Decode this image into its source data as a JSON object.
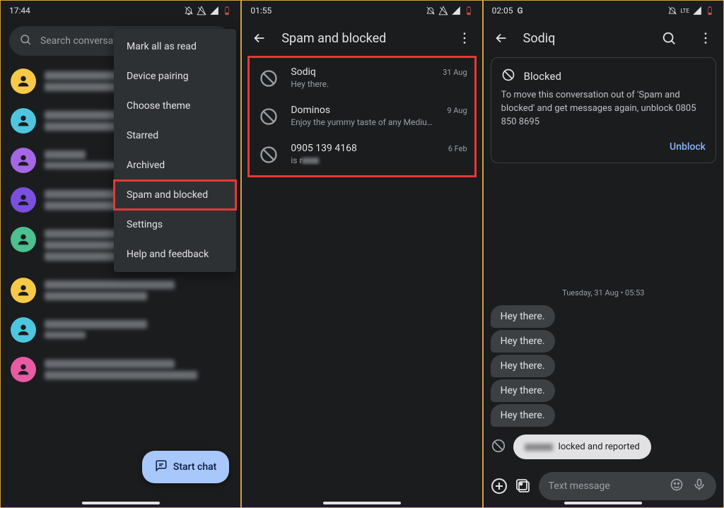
{
  "screen1": {
    "status": {
      "time": "17:44"
    },
    "search_placeholder": "Search conversati",
    "menu": {
      "items": [
        "Mark all as read",
        "Device pairing",
        "Choose theme",
        "Starred",
        "Archived",
        "Spam and blocked",
        "Settings",
        "Help and feedback"
      ],
      "highlight_index": 5
    },
    "fab_label": "Start chat"
  },
  "screen2": {
    "status": {
      "time": "01:55"
    },
    "title": "Spam and blocked",
    "items": [
      {
        "name": "Sodiq",
        "preview": "Hey there.",
        "date": "31 Aug"
      },
      {
        "name": "Dominos",
        "preview": "Enjoy the yummy taste of any Medium …",
        "date": "9 Aug"
      },
      {
        "name": "0905 139 4168",
        "preview_prefix": "is r",
        "date": "6 Feb"
      }
    ]
  },
  "screen3": {
    "status": {
      "time": "02:05",
      "g": "G",
      "net": "LTE"
    },
    "title": "Sodiq",
    "blocked": {
      "heading": "Blocked",
      "body": "To move this conversation out of 'Spam and blocked' and get messages again, unblock 0805 850 8695",
      "action": "Unblock"
    },
    "date_line": "Tuesday, 31 Aug • 05:53",
    "messages": [
      "Hey there.",
      "Hey there.",
      "Hey there.",
      "Hey there.",
      "Hey there."
    ],
    "report_suffix": "locked and reported",
    "compose_placeholder": "Text message"
  }
}
